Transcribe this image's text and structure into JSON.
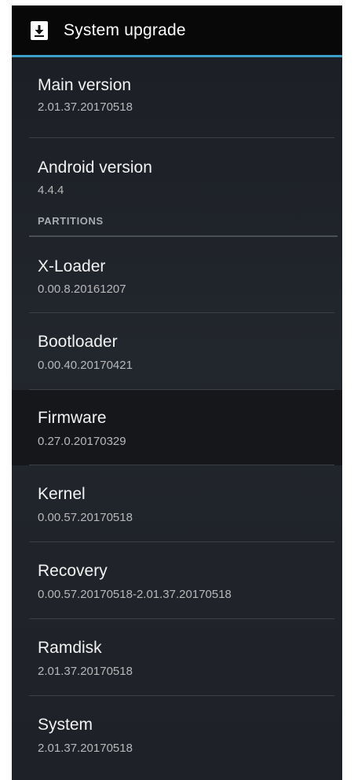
{
  "action_bar": {
    "title": "System upgrade",
    "icon": "download-icon",
    "accent_color": "#3aa0c8"
  },
  "items_top": [
    {
      "title": "Main version",
      "summary": "2.01.37.20170518"
    },
    {
      "title": "Android version",
      "summary": "4.4.4"
    }
  ],
  "category": {
    "label": "PARTITIONS"
  },
  "partitions": [
    {
      "title": "X-Loader",
      "summary": "0.00.8.20161207"
    },
    {
      "title": "Bootloader",
      "summary": "0.00.40.20170421"
    },
    {
      "title": "Firmware",
      "summary": "0.27.0.20170329"
    },
    {
      "title": "Kernel",
      "summary": "0.00.57.20170518"
    },
    {
      "title": "Recovery",
      "summary": "0.00.57.20170518-2.01.37.20170518"
    },
    {
      "title": "Ramdisk",
      "summary": "2.01.37.20170518"
    },
    {
      "title": "System",
      "summary": "2.01.37.20170518"
    }
  ]
}
